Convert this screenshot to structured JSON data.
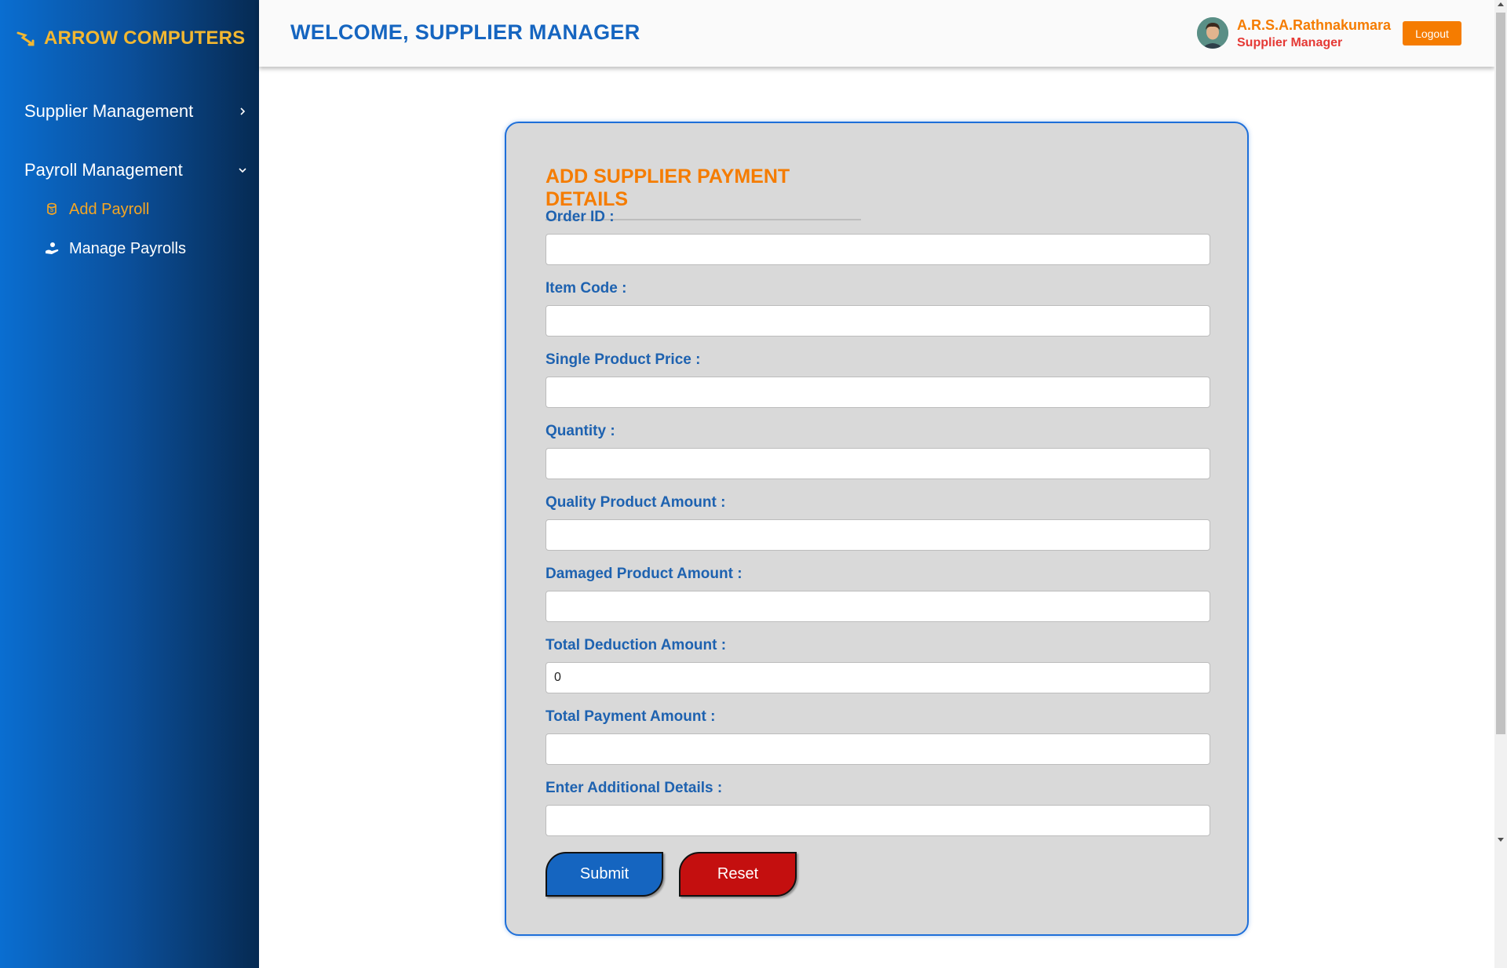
{
  "sidebar": {
    "brand": "ARROW COMPUTERS",
    "groups": [
      {
        "label": "Supplier Management",
        "expanded": false
      },
      {
        "label": "Payroll Management",
        "expanded": true,
        "items": [
          {
            "label": "Add Payroll",
            "icon": "coin-stack-icon",
            "active": true
          },
          {
            "label": "Manage Payrolls",
            "icon": "hand-money-icon",
            "active": false
          }
        ]
      }
    ]
  },
  "header": {
    "welcome": "WELCOME, SUPPLIER MANAGER",
    "user_name": "A.R.S.A.Rathnakumara",
    "user_role": "Supplier Manager",
    "logout_label": "Logout"
  },
  "form": {
    "title": "ADD SUPPLIER PAYMENT DETAILS",
    "fields": [
      {
        "label": "Order ID :",
        "value": ""
      },
      {
        "label": "Item Code :",
        "value": ""
      },
      {
        "label": "Single Product Price :",
        "value": ""
      },
      {
        "label": "Quantity :",
        "value": ""
      },
      {
        "label": "Quality Product Amount :",
        "value": ""
      },
      {
        "label": "Damaged Product Amount :",
        "value": ""
      },
      {
        "label": "Total Deduction Amount :",
        "value": "0"
      },
      {
        "label": "Total Payment Amount :",
        "value": ""
      },
      {
        "label": "Enter Additional Details :",
        "value": ""
      }
    ],
    "submit_label": "Submit",
    "reset_label": "Reset"
  },
  "colors": {
    "accent_blue": "#1565c0",
    "accent_orange": "#f57c00",
    "brand_gold": "#f2b731",
    "reset_red": "#c40f0f"
  }
}
